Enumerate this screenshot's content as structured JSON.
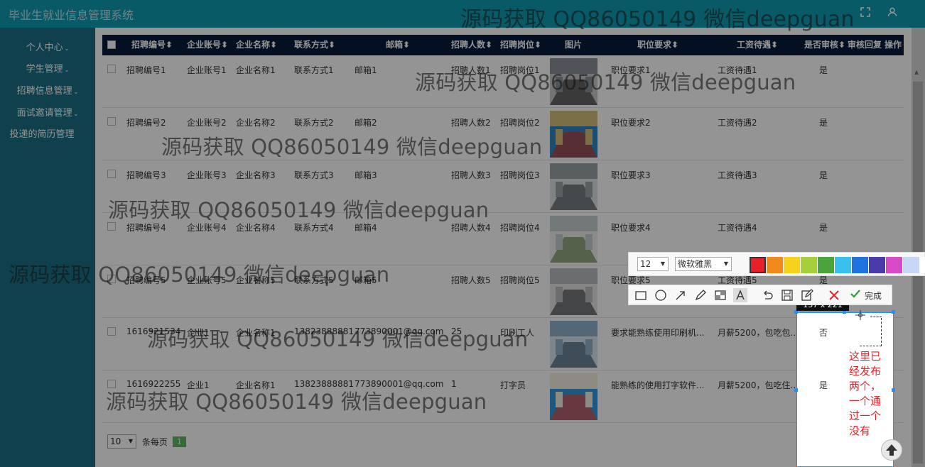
{
  "app": {
    "title": "毕业生就业信息管理系统"
  },
  "topbar": {
    "fullscreen_icon": "expand-icon",
    "user_icon": "user-icon"
  },
  "sidebar": {
    "items": [
      {
        "label": "个人中心"
      },
      {
        "label": "学生管理"
      },
      {
        "label": "招聘信息管理"
      },
      {
        "label": "面试邀请管理"
      },
      {
        "label": "投递的简历管理"
      }
    ]
  },
  "table": {
    "headers": [
      "招聘编号",
      "企业账号",
      "企业名称",
      "联系方式",
      "邮箱",
      "招聘人数",
      "招聘岗位",
      "图片",
      "职位要求",
      "工资待遇",
      "是否审核",
      "审核回复",
      "操作"
    ],
    "sort_icon": "sort-icon",
    "rows": [
      {
        "code": "招聘编号1",
        "account": "企业账号1",
        "name": "企业名称1",
        "contact": "联系方式1",
        "email": "邮箱1",
        "count": "招聘人数1",
        "post": "招聘岗位1",
        "req": "职位要求1",
        "salary": "工资待遇1",
        "audit": "是"
      },
      {
        "code": "招聘编号2",
        "account": "企业账号2",
        "name": "企业名称2",
        "contact": "联系方式2",
        "email": "邮箱2",
        "count": "招聘人数2",
        "post": "招聘岗位2",
        "req": "职位要求2",
        "salary": "工资待遇2",
        "audit": "是"
      },
      {
        "code": "招聘编号3",
        "account": "企业账号3",
        "name": "企业名称3",
        "contact": "联系方式3",
        "email": "邮箱3",
        "count": "招聘人数3",
        "post": "招聘岗位3",
        "req": "职位要求3",
        "salary": "工资待遇3",
        "audit": "是"
      },
      {
        "code": "招聘编号4",
        "account": "企业账号4",
        "name": "企业名称4",
        "contact": "联系方式4",
        "email": "邮箱4",
        "count": "招聘人数4",
        "post": "招聘岗位4",
        "req": "职位要求4",
        "salary": "工资待遇4",
        "audit": "是"
      },
      {
        "code": "招聘编号5",
        "account": "企业账号5",
        "name": "企业名称5",
        "contact": "联系方式5",
        "email": "邮箱5",
        "count": "招聘人数5",
        "post": "招聘岗位5",
        "req": "职位要求5",
        "salary": "工资待遇5",
        "audit": "是"
      },
      {
        "code": "1616921534",
        "account": "企业1",
        "name": "企业名称1",
        "contact": "13823888881",
        "email": "773890001@qq.com",
        "count": "25",
        "post": "印刷工人",
        "req": "要求能熟练使用印刷机...",
        "salary": "月薪5200，包吃包...",
        "audit": "否"
      },
      {
        "code": "1616922255",
        "account": "企业1",
        "name": "企业名称1",
        "contact": "13823888881",
        "email": "773890001@qq.com",
        "count": "1",
        "post": "打字员",
        "req": "能熟练的使用打字软件...",
        "salary": "月薪5200，包吃住...",
        "audit": "是"
      }
    ]
  },
  "pager": {
    "page_size": "10",
    "per_page_label": "条每页",
    "current_page": "1"
  },
  "screenshot_tool": {
    "font_size": "12",
    "font_family": "微软雅黑",
    "colors": [
      "#e8202a",
      "#f08a1c",
      "#f5d31c",
      "#a6cf3c",
      "#4aa43a",
      "#39c0ec",
      "#1e73e0",
      "#4a3aaa",
      "#d84ac8",
      "#c8d6f8",
      "#ffffff"
    ],
    "tools": [
      "rectangle-icon",
      "ellipse-icon",
      "arrow-icon",
      "pen-icon",
      "mosaic-icon",
      "text-icon"
    ],
    "actions": [
      "undo-icon",
      "save-icon",
      "edit-icon"
    ],
    "cancel_icon": "close-icon",
    "done_label": "完成",
    "selection_size": "137 x 221",
    "annotation_text": "这里已经发布两个，一个通过一个没有",
    "selection_no": "否",
    "selection_yes": "是"
  },
  "watermark": {
    "text": "源码获取 QQ86050149 微信deepguan"
  }
}
